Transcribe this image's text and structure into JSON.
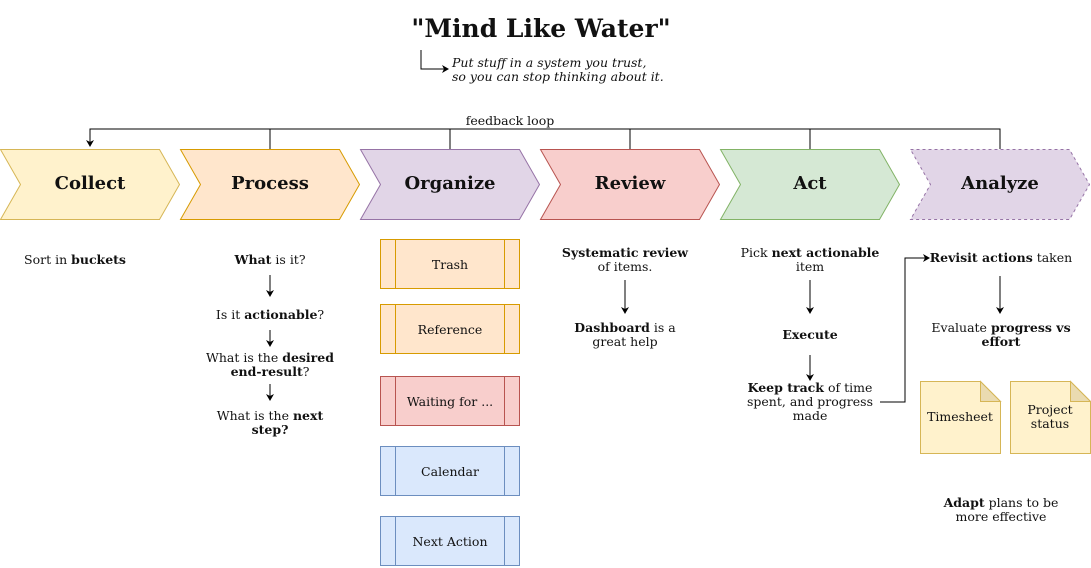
{
  "title": "\"Mind Like Water\"",
  "subtitle": [
    "Put stuff in a system you trust,",
    "so you can stop thinking about it."
  ],
  "feedback_label": "feedback loop",
  "colors": {
    "collect": {
      "fill": "#fff2cc",
      "stroke": "#d6b656"
    },
    "process": {
      "fill": "#ffe6cc",
      "stroke": "#d79b00"
    },
    "organize": {
      "fill": "#e1d5e7",
      "stroke": "#9673a6"
    },
    "review": {
      "fill": "#f8cecc",
      "stroke": "#b85450"
    },
    "act": {
      "fill": "#d5e8d4",
      "stroke": "#82b366"
    },
    "analyze": {
      "fill": "#e1d5e7",
      "stroke": "#9673a6"
    },
    "bucket_orange": {
      "fill": "#ffe6cc",
      "stroke": "#d79b00"
    },
    "bucket_red": {
      "fill": "#f8cecc",
      "stroke": "#b85450"
    },
    "bucket_blue": {
      "fill": "#dae8fc",
      "stroke": "#6c8ebf"
    },
    "note": {
      "fill": "#fff2cc",
      "stroke": "#d6b656"
    }
  },
  "stages": [
    {
      "label": "Collect"
    },
    {
      "label": "Process"
    },
    {
      "label": "Organize"
    },
    {
      "label": "Review"
    },
    {
      "label": "Act"
    },
    {
      "label": "Analyze"
    }
  ],
  "collect": {
    "pre": "Sort in ",
    "bold": "buckets"
  },
  "process": {
    "q1": {
      "bold": "What",
      "post": " is it?"
    },
    "q2": {
      "pre": "Is it ",
      "bold": "actionable",
      "post": "?"
    },
    "q3": {
      "pre": "What is the ",
      "bold1": "desired",
      "bold2": "end-result",
      "post": "?"
    },
    "q4": {
      "pre": "What is the ",
      "bold1": "next",
      "bold2": "step?"
    }
  },
  "organize": {
    "buckets": [
      {
        "label": "Trash"
      },
      {
        "label": "Reference"
      },
      {
        "label": "Waiting for ..."
      },
      {
        "label": "Calendar"
      },
      {
        "label": "Next Action"
      }
    ]
  },
  "review": {
    "r1": {
      "bold": "Systematic review",
      "line2": "of items."
    },
    "r2": {
      "bold": "Dashboard",
      "post": " is a",
      "line2": "great help"
    }
  },
  "act": {
    "a1": {
      "pre": "Pick ",
      "bold": "next actionable",
      "line2": "item"
    },
    "a2": {
      "bold": "Execute"
    },
    "a3": {
      "bold": "Keep track",
      "post": " of time",
      "line2": "spent, and progress",
      "line3": "made"
    }
  },
  "analyze": {
    "n1": {
      "bold": "Revisit actions",
      "post": " taken"
    },
    "n2": {
      "pre": "Evaluate ",
      "bold1": "progress vs",
      "bold2": "effort"
    },
    "notes": [
      {
        "label": "Timesheet"
      },
      {
        "label": "Project status"
      }
    ],
    "n3": {
      "bold": "Adapt",
      "post": " plans to be",
      "line2": "more effective"
    }
  }
}
